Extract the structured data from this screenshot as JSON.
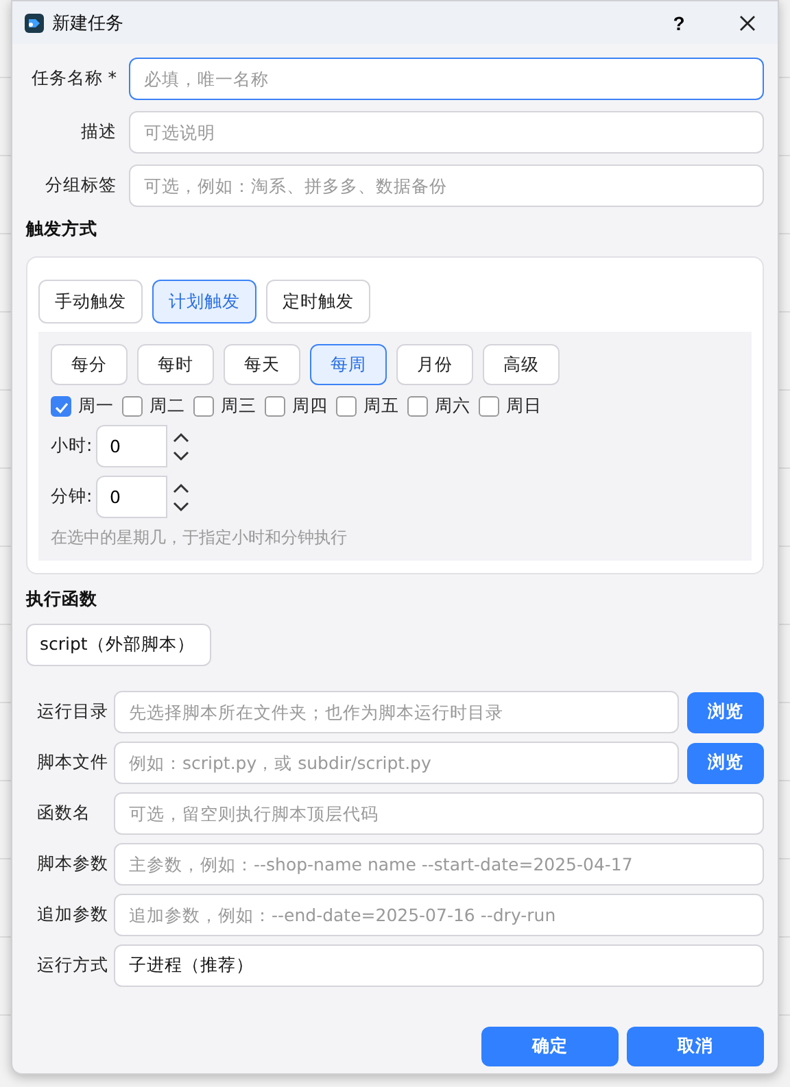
{
  "window": {
    "title": "新建任务",
    "help": "?"
  },
  "basic_fields": [
    {
      "label": "任务名称 *",
      "placeholder": "必填，唯一名称",
      "focused": true
    },
    {
      "label": "描述",
      "placeholder": "可选说明",
      "focused": false
    },
    {
      "label": "分组标签",
      "placeholder": "可选，例如：淘系、拼多多、数据备份",
      "focused": false
    }
  ],
  "trigger": {
    "heading": "触发方式",
    "modes": [
      {
        "label": "手动触发",
        "selected": false
      },
      {
        "label": "计划触发",
        "selected": true
      },
      {
        "label": "定时触发",
        "selected": false
      }
    ],
    "frequencies": [
      {
        "label": "每分",
        "selected": false
      },
      {
        "label": "每时",
        "selected": false
      },
      {
        "label": "每天",
        "selected": false
      },
      {
        "label": "每周",
        "selected": true
      },
      {
        "label": "月份",
        "selected": false
      },
      {
        "label": "高级",
        "selected": false
      }
    ],
    "weekdays": [
      {
        "label": "周一",
        "checked": true
      },
      {
        "label": "周二",
        "checked": false
      },
      {
        "label": "周三",
        "checked": false
      },
      {
        "label": "周四",
        "checked": false
      },
      {
        "label": "周五",
        "checked": false
      },
      {
        "label": "周六",
        "checked": false
      },
      {
        "label": "周日",
        "checked": false
      }
    ],
    "spinners": [
      {
        "label": "小时:",
        "value": "0"
      },
      {
        "label": "分钟:",
        "value": "0"
      }
    ],
    "hint": "在选中的星期几，于指定小时和分钟执行"
  },
  "function": {
    "heading": "执行函数",
    "value": "script（外部脚本）"
  },
  "script_fields": [
    {
      "kind": "browse",
      "label": "运行目录",
      "placeholder": "先选择脚本所在文件夹；也作为脚本运行时目录",
      "button": "浏览"
    },
    {
      "kind": "browse",
      "label": "脚本文件",
      "placeholder": "例如：script.py，或 subdir/script.py",
      "button": "浏览"
    },
    {
      "kind": "text",
      "label": "函数名",
      "placeholder": "可选，留空则执行脚本顶层代码"
    },
    {
      "kind": "text",
      "label": "脚本参数",
      "placeholder": "主参数，例如：--shop-name name --start-date=2025-04-17"
    },
    {
      "kind": "text",
      "label": "追加参数",
      "placeholder": "追加参数，例如：--end-date=2025-07-16 --dry-run"
    },
    {
      "kind": "text",
      "label": "运行方式",
      "value": "子进程（推荐）"
    }
  ],
  "buttons": [
    "确定",
    "取消"
  ]
}
